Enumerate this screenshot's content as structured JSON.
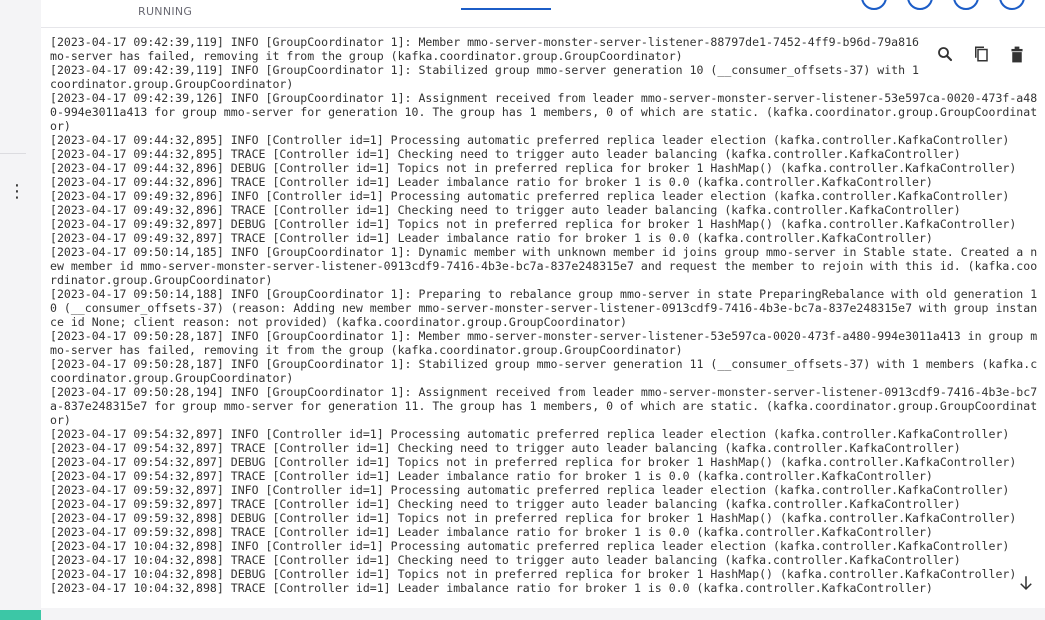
{
  "header": {
    "status": "RUNNING"
  },
  "log_tools": [
    "search-icon",
    "copy-icon",
    "trash-icon"
  ],
  "log": [
    "[2023-04-17 09:42:39,119] INFO [GroupCoordinator 1]: Member mmo-server-monster-server-listener-88797de1-7452-4ff9-b96d-79a816",
    "mo-server has failed, removing it from the group (kafka.coordinator.group.GroupCoordinator)",
    "[2023-04-17 09:42:39,119] INFO [GroupCoordinator 1]: Stabilized group mmo-server generation 10 (__consumer_offsets-37) with 1 m",
    "coordinator.group.GroupCoordinator)",
    "[2023-04-17 09:42:39,126] INFO [GroupCoordinator 1]: Assignment received from leader mmo-server-monster-server-listener-53e597ca-0020-473f-a48",
    "0-994e3011a413 for group mmo-server for generation 10. The group has 1 members, 0 of which are static. (kafka.coordinator.group.GroupCoordinat",
    "or)",
    "[2023-04-17 09:44:32,895] INFO [Controller id=1] Processing automatic preferred replica leader election (kafka.controller.KafkaController)",
    "[2023-04-17 09:44:32,895] TRACE [Controller id=1] Checking need to trigger auto leader balancing (kafka.controller.KafkaController)",
    "[2023-04-17 09:44:32,896] DEBUG [Controller id=1] Topics not in preferred replica for broker 1 HashMap() (kafka.controller.KafkaController)",
    "[2023-04-17 09:44:32,896] TRACE [Controller id=1] Leader imbalance ratio for broker 1 is 0.0 (kafka.controller.KafkaController)",
    "[2023-04-17 09:49:32,896] INFO [Controller id=1] Processing automatic preferred replica leader election (kafka.controller.KafkaController)",
    "[2023-04-17 09:49:32,896] TRACE [Controller id=1] Checking need to trigger auto leader balancing (kafka.controller.KafkaController)",
    "[2023-04-17 09:49:32,897] DEBUG [Controller id=1] Topics not in preferred replica for broker 1 HashMap() (kafka.controller.KafkaController)",
    "[2023-04-17 09:49:32,897] TRACE [Controller id=1] Leader imbalance ratio for broker 1 is 0.0 (kafka.controller.KafkaController)",
    "[2023-04-17 09:50:14,185] INFO [GroupCoordinator 1]: Dynamic member with unknown member id joins group mmo-server in Stable state. Created a n",
    "ew member id mmo-server-monster-server-listener-0913cdf9-7416-4b3e-bc7a-837e248315e7 and request the member to rejoin with this id. (kafka.coo",
    "rdinator.group.GroupCoordinator)",
    "[2023-04-17 09:50:14,188] INFO [GroupCoordinator 1]: Preparing to rebalance group mmo-server in state PreparingRebalance with old generation 1",
    "0 (__consumer_offsets-37) (reason: Adding new member mmo-server-monster-server-listener-0913cdf9-7416-4b3e-bc7a-837e248315e7 with group instan",
    "ce id None; client reason: not provided) (kafka.coordinator.group.GroupCoordinator)",
    "[2023-04-17 09:50:28,187] INFO [GroupCoordinator 1]: Member mmo-server-monster-server-listener-53e597ca-0020-473f-a480-994e3011a413 in group m",
    "mo-server has failed, removing it from the group (kafka.coordinator.group.GroupCoordinator)",
    "[2023-04-17 09:50:28,187] INFO [GroupCoordinator 1]: Stabilized group mmo-server generation 11 (__consumer_offsets-37) with 1 members (kafka.c",
    "coordinator.group.GroupCoordinator)",
    "[2023-04-17 09:50:28,194] INFO [GroupCoordinator 1]: Assignment received from leader mmo-server-monster-server-listener-0913cdf9-7416-4b3e-bc7",
    "a-837e248315e7 for group mmo-server for generation 11. The group has 1 members, 0 of which are static. (kafka.coordinator.group.GroupCoordinat",
    "or)",
    "[2023-04-17 09:54:32,897] INFO [Controller id=1] Processing automatic preferred replica leader election (kafka.controller.KafkaController)",
    "[2023-04-17 09:54:32,897] TRACE [Controller id=1] Checking need to trigger auto leader balancing (kafka.controller.KafkaController)",
    "[2023-04-17 09:54:32,897] DEBUG [Controller id=1] Topics not in preferred replica for broker 1 HashMap() (kafka.controller.KafkaController)",
    "[2023-04-17 09:54:32,897] TRACE [Controller id=1] Leader imbalance ratio for broker 1 is 0.0 (kafka.controller.KafkaController)",
    "[2023-04-17 09:59:32,897] INFO [Controller id=1] Processing automatic preferred replica leader election (kafka.controller.KafkaController)",
    "[2023-04-17 09:59:32,897] TRACE [Controller id=1] Checking need to trigger auto leader balancing (kafka.controller.KafkaController)",
    "[2023-04-17 09:59:32,898] DEBUG [Controller id=1] Topics not in preferred replica for broker 1 HashMap() (kafka.controller.KafkaController)",
    "[2023-04-17 09:59:32,898] TRACE [Controller id=1] Leader imbalance ratio for broker 1 is 0.0 (kafka.controller.KafkaController)",
    "[2023-04-17 10:04:32,898] INFO [Controller id=1] Processing automatic preferred replica leader election (kafka.controller.KafkaController)",
    "[2023-04-17 10:04:32,898] TRACE [Controller id=1] Checking need to trigger auto leader balancing (kafka.controller.KafkaController)",
    "[2023-04-17 10:04:32,898] DEBUG [Controller id=1] Topics not in preferred replica for broker 1 HashMap() (kafka.controller.KafkaController)",
    "[2023-04-17 10:04:32,898] TRACE [Controller id=1] Leader imbalance ratio for broker 1 is 0.0 (kafka.controller.KafkaController)"
  ],
  "colors": {
    "accent": "#1c5dc7",
    "status_green": "#3cc7a6"
  }
}
